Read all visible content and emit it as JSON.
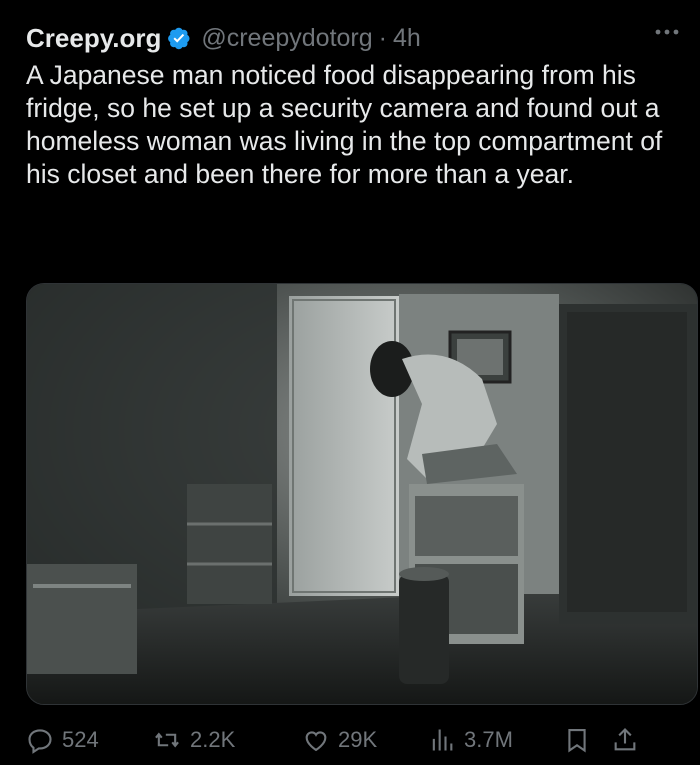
{
  "tweet": {
    "author_name": "Creepy.org",
    "handle": "@creepydotorg",
    "separator": "·",
    "time": "4h",
    "text": "A Japanese man noticed food disappearing from his fridge, so he set up a security camera and found out a homeless woman was living in the top compartment of his closet and been there for more than a year."
  },
  "actions": {
    "replies": "524",
    "retweets": "2.2K",
    "likes": "29K",
    "views": "3.7M"
  },
  "colors": {
    "background": "#000000",
    "text": "#e7e9ea",
    "muted": "#71767b",
    "verified": "#1d9bf0"
  },
  "icons": [
    "verified-badge-icon",
    "more-icon",
    "reply-icon",
    "retweet-icon",
    "like-icon",
    "views-icon",
    "bookmark-icon",
    "share-icon"
  ]
}
